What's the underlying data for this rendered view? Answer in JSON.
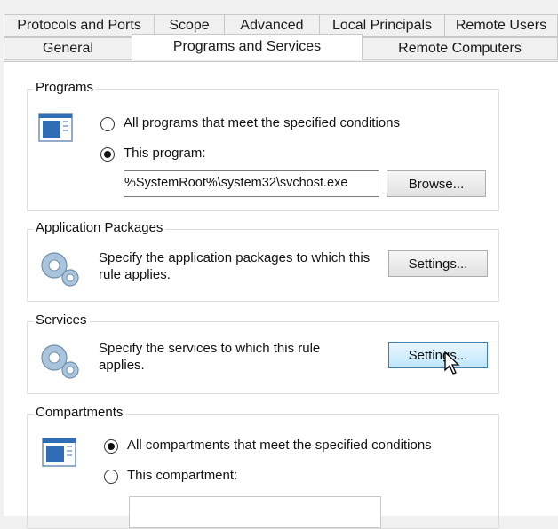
{
  "tabs_row1": [
    "Protocols and Ports",
    "Scope",
    "Advanced",
    "Local Principals",
    "Remote Users"
  ],
  "tabs_row2": [
    "General",
    "Programs and Services",
    "Remote Computers"
  ],
  "programs": {
    "legend": "Programs",
    "option_all": "All programs that meet the specified conditions",
    "option_this": "This program:",
    "selected": "this",
    "path_value": "%SystemRoot%\\system32\\svchost.exe",
    "browse_label": "Browse..."
  },
  "app_packages": {
    "legend": "Application Packages",
    "description": "Specify the application packages to which this rule applies.",
    "settings_label": "Settings..."
  },
  "services": {
    "legend": "Services",
    "description": "Specify the services to which this rule applies.",
    "settings_label": "Settings..."
  },
  "compartments": {
    "legend": "Compartments",
    "option_all": "All compartments that meet the specified conditions",
    "option_this": "This compartment:",
    "selected": "all",
    "compartment_value": ""
  }
}
